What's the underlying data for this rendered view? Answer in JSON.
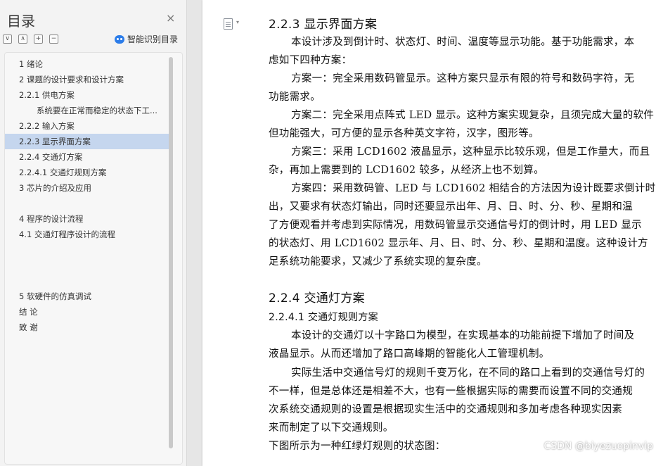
{
  "toc": {
    "title": "目录",
    "close_glyph": "×",
    "tools": [
      "∨",
      "∧",
      "+",
      "−"
    ],
    "smart_label": "智能识别目录",
    "items": [
      {
        "label": "1   绪论"
      },
      {
        "label": "2   课题的设计要求和设计方案"
      },
      {
        "label": "2.2.1  供电方案"
      },
      {
        "label": "系统要在正常而稳定的状态下工..."
      },
      {
        "label": "2.2.2  输入方案"
      },
      {
        "label": "2.2.3  显示界面方案"
      },
      {
        "label": "2.2.4 交通灯方案"
      },
      {
        "label": "2.2.4.1 交通灯规则方案"
      },
      {
        "label": "3    芯片的介绍及应用"
      },
      {
        "label": "4    程序的设计流程"
      },
      {
        "label": "4.1  交通灯程序设计的流程"
      },
      {
        "label": "5    软硬件的仿真调试"
      },
      {
        "label": "结  论"
      },
      {
        "label": "致  谢"
      }
    ],
    "active_index": 5
  },
  "doc": {
    "lines": [
      "2.2.3  显示界面方案",
      "本设计涉及到倒计时、状态灯、时间、温度等显示功能。基于功能需求，本",
      "虑如下四种方案：",
      "方案一：完全采用数码管显示。这种方案只显示有限的符号和数码字符，无",
      "功能需求。",
      "方案二：完全采用点阵式 LED  显示。这种方案实现复杂，且须完成大量的软件",
      "但功能强大，可方便的显示各种英文字符，汉字，图形等。",
      "方案三：采用 LCD1602 液晶显示，这种显示比较乐观，但是工作量大，而且",
      "杂，再加上需要到的 LCD1602 较多，从经济上也不划算。",
      "方案四：采用数码管、LED 与 LCD1602 相结合的方法因为设计既要求倒计时",
      "出，又要求有状态灯输出，同时还要显示出年、月、日、时、分、秒、星期和温",
      "了方便观看并考虑到实际情况，用数码管显示交通信号灯的倒计时，用 LED 显示",
      "的状态灯、用 LCD1602 显示年、月、日、时、分、秒、星期和温度。这种设计方",
      "足系统功能要求，又减少了系统实现的复杂度。",
      "2.2.4 交通灯方案",
      "2.2.4.1 交通灯规则方案",
      "本设计的交通灯以十字路口为模型，在实现基本的功能前提下增加了时间及",
      "液晶显示。从而还增加了路口高峰期的智能化人工管理机制。",
      "实际生活中交通信号灯的规则千变万化，在不同的路口上看到的交通信号灯的",
      "不一样，但是总体还是相差不大，也有一些根据实际的需要而设置不同的交通规",
      "次系统交通规则的设置是根据现实生活中的交通规则和多加考虑各种现实因素",
      "来而制定了以下交通规则。",
      "下图所示为一种红绿灯规则的状态图："
    ]
  },
  "watermark": "CSDN @biyezuopinvip",
  "colors": {
    "active_bg": "#c5d6ee",
    "accent": "#2b7ce9"
  }
}
